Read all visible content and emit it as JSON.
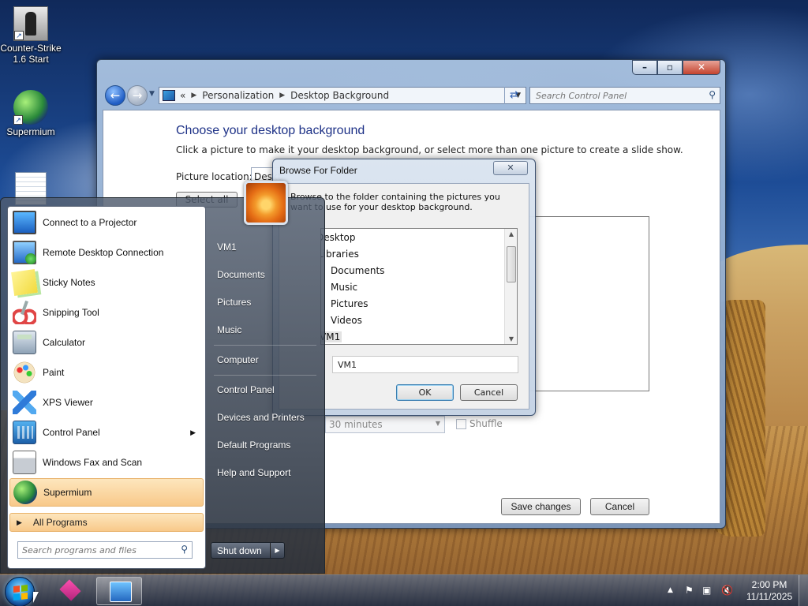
{
  "desktop": {
    "icons": [
      {
        "label": "Counter-Strike 1.6 Start"
      },
      {
        "label": "Supermium"
      }
    ]
  },
  "control_panel": {
    "breadcrumb": [
      "Personalization",
      "Desktop Background"
    ],
    "search_placeholder": "Search Control Panel",
    "heading": "Choose your desktop background",
    "description": "Click a picture to make it your desktop background, or select more than one picture to create a slide show.",
    "picture_location_label": "Picture location:",
    "picture_location_value": "Desktop Backgrounds",
    "select_all_label": "Select all",
    "interval_value": "30 minutes",
    "shuffle_label": "Shuffle",
    "save_label": "Save changes",
    "cancel_label": "Cancel"
  },
  "dialog": {
    "title": "Browse For Folder",
    "instruction": "Browse to the folder containing the pictures you want to use for your desktop background.",
    "tree": [
      "Desktop",
      "Libraries",
      "Documents",
      "Music",
      "Pictures",
      "Videos",
      "VM1"
    ],
    "selected_folder": "VM1",
    "ok_label": "OK",
    "cancel_label": "Cancel"
  },
  "start_menu": {
    "programs": [
      {
        "label": "Connect to a Projector",
        "icon": "projector-icon"
      },
      {
        "label": "Remote Desktop Connection",
        "icon": "remote-desktop-icon"
      },
      {
        "label": "Sticky Notes",
        "icon": "sticky-notes-icon"
      },
      {
        "label": "Snipping Tool",
        "icon": "snipping-tool-icon"
      },
      {
        "label": "Calculator",
        "icon": "calculator-icon"
      },
      {
        "label": "Paint",
        "icon": "paint-icon"
      },
      {
        "label": "XPS Viewer",
        "icon": "xps-viewer-icon"
      },
      {
        "label": "Control Panel",
        "icon": "control-panel-icon"
      },
      {
        "label": "Windows Fax and Scan",
        "icon": "fax-scan-icon"
      },
      {
        "label": "Supermium",
        "icon": "supermium-icon"
      }
    ],
    "all_programs_label": "All Programs",
    "search_placeholder": "Search programs and files",
    "right_items": [
      "VM1",
      "Documents",
      "Pictures",
      "Music",
      "Computer",
      "Control Panel",
      "Devices and Printers",
      "Default Programs",
      "Help and Support"
    ],
    "shutdown_label": "Shut down"
  },
  "taskbar": {
    "time": "2:00 PM",
    "date": "11/11/2025"
  }
}
